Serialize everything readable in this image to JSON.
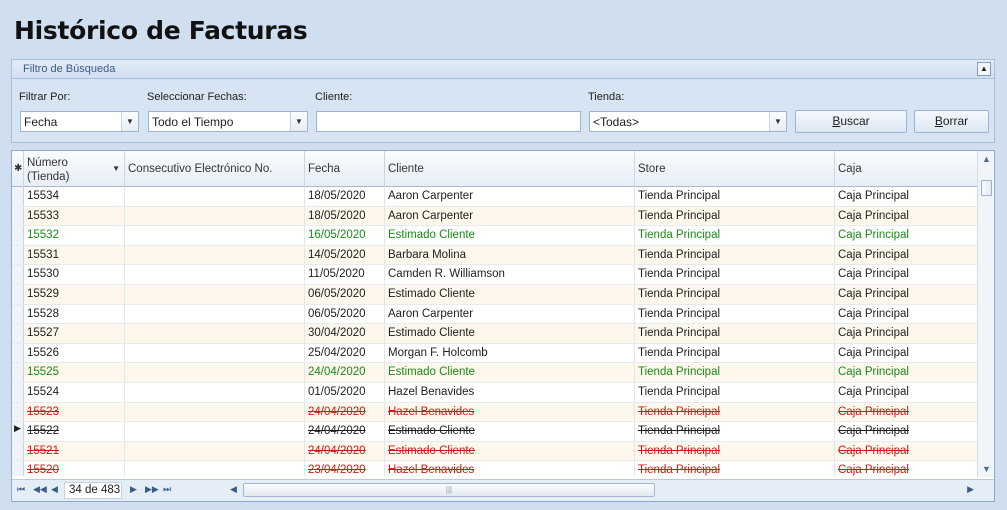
{
  "page": {
    "title": "Histórico de Facturas"
  },
  "filter": {
    "header": "Filtro de Búsqueda",
    "filter_by_label": "Filtrar Por:",
    "filter_by_value": "Fecha",
    "dates_label": "Seleccionar Fechas:",
    "dates_value": "Todo el Tiempo",
    "client_label": "Cliente:",
    "client_value": "",
    "store_label": "Tienda:",
    "store_value": "<Todas>",
    "search_button": "Buscar",
    "search_mnemonic": "B",
    "search_rest": "uscar",
    "clear_mnemonic": "B",
    "clear_rest": "orrar",
    "clear_button": "Borrar"
  },
  "grid": {
    "columns": {
      "numero_line1": "Número",
      "numero_line2": "(Tienda)",
      "consecutivo": "Consecutivo Electrónico No.",
      "fecha": "Fecha",
      "cliente": "Cliente",
      "store": "Store",
      "caja": "Caja"
    },
    "rows": [
      {
        "numero": "15534",
        "consecutivo": "",
        "fecha": "18/05/2020",
        "cliente": "Aaron Carpenter",
        "store": "Tienda Principal",
        "caja": "Caja Principal",
        "status": "normal"
      },
      {
        "numero": "15533",
        "consecutivo": "",
        "fecha": "18/05/2020",
        "cliente": "Aaron Carpenter",
        "store": "Tienda Principal",
        "caja": "Caja Principal",
        "status": "normal"
      },
      {
        "numero": "15532",
        "consecutivo": "",
        "fecha": "16/05/2020",
        "cliente": "Estimado Cliente",
        "store": "Tienda Principal",
        "caja": "Caja Principal",
        "status": "green"
      },
      {
        "numero": "15531",
        "consecutivo": "",
        "fecha": "14/05/2020",
        "cliente": "Barbara Molina",
        "store": "Tienda Principal",
        "caja": "Caja Principal",
        "status": "normal"
      },
      {
        "numero": "15530",
        "consecutivo": "",
        "fecha": "11/05/2020",
        "cliente": "Camden R. Williamson",
        "store": "Tienda Principal",
        "caja": "Caja Principal",
        "status": "normal"
      },
      {
        "numero": "15529",
        "consecutivo": "",
        "fecha": "06/05/2020",
        "cliente": "Estimado Cliente",
        "store": "Tienda Principal",
        "caja": "Caja Principal",
        "status": "normal"
      },
      {
        "numero": "15528",
        "consecutivo": "",
        "fecha": "06/05/2020",
        "cliente": "Aaron Carpenter",
        "store": "Tienda Principal",
        "caja": "Caja Principal",
        "status": "normal"
      },
      {
        "numero": "15527",
        "consecutivo": "",
        "fecha": "30/04/2020",
        "cliente": "Estimado Cliente",
        "store": "Tienda Principal",
        "caja": "Caja Principal",
        "status": "normal"
      },
      {
        "numero": "15526",
        "consecutivo": "",
        "fecha": "25/04/2020",
        "cliente": "Morgan F. Holcomb",
        "store": "Tienda Principal",
        "caja": "Caja Principal",
        "status": "normal"
      },
      {
        "numero": "15525",
        "consecutivo": "",
        "fecha": "24/04/2020",
        "cliente": "Estimado Cliente",
        "store": "Tienda Principal",
        "caja": "Caja Principal",
        "status": "green"
      },
      {
        "numero": "15524",
        "consecutivo": "",
        "fecha": "01/05/2020",
        "cliente": "Hazel Benavides",
        "store": "Tienda Principal",
        "caja": "Caja Principal",
        "status": "normal"
      },
      {
        "numero": "15523",
        "consecutivo": "",
        "fecha": "24/04/2020",
        "cliente": "Hazel Benavides",
        "store": "Tienda Principal",
        "caja": "Caja Principal",
        "status": "red"
      },
      {
        "numero": "15522",
        "consecutivo": "",
        "fecha": "24/04/2020",
        "cliente": "Estimado Cliente",
        "store": "Tienda Principal",
        "caja": "Caja Principal",
        "status": "selected"
      },
      {
        "numero": "15521",
        "consecutivo": "",
        "fecha": "24/04/2020",
        "cliente": "Estimado Cliente",
        "store": "Tienda Principal",
        "caja": "Caja Principal",
        "status": "red"
      },
      {
        "numero": "15520",
        "consecutivo": "",
        "fecha": "23/04/2020",
        "cliente": "Hazel Benavides",
        "store": "Tienda Principal",
        "caja": "Caja Principal",
        "status": "red"
      }
    ]
  },
  "navigator": {
    "page_text": "34 de 483"
  },
  "colors": {
    "green": "#1a8a1a",
    "red": "#d21717",
    "background": "#cfdff0"
  },
  "icons": {
    "first": "double-left-arrow-icon",
    "prev_page": "double-left-icon",
    "prev": "left-arrow-icon",
    "next": "right-arrow-icon",
    "next_page": "double-right-icon",
    "last": "last-icon"
  }
}
